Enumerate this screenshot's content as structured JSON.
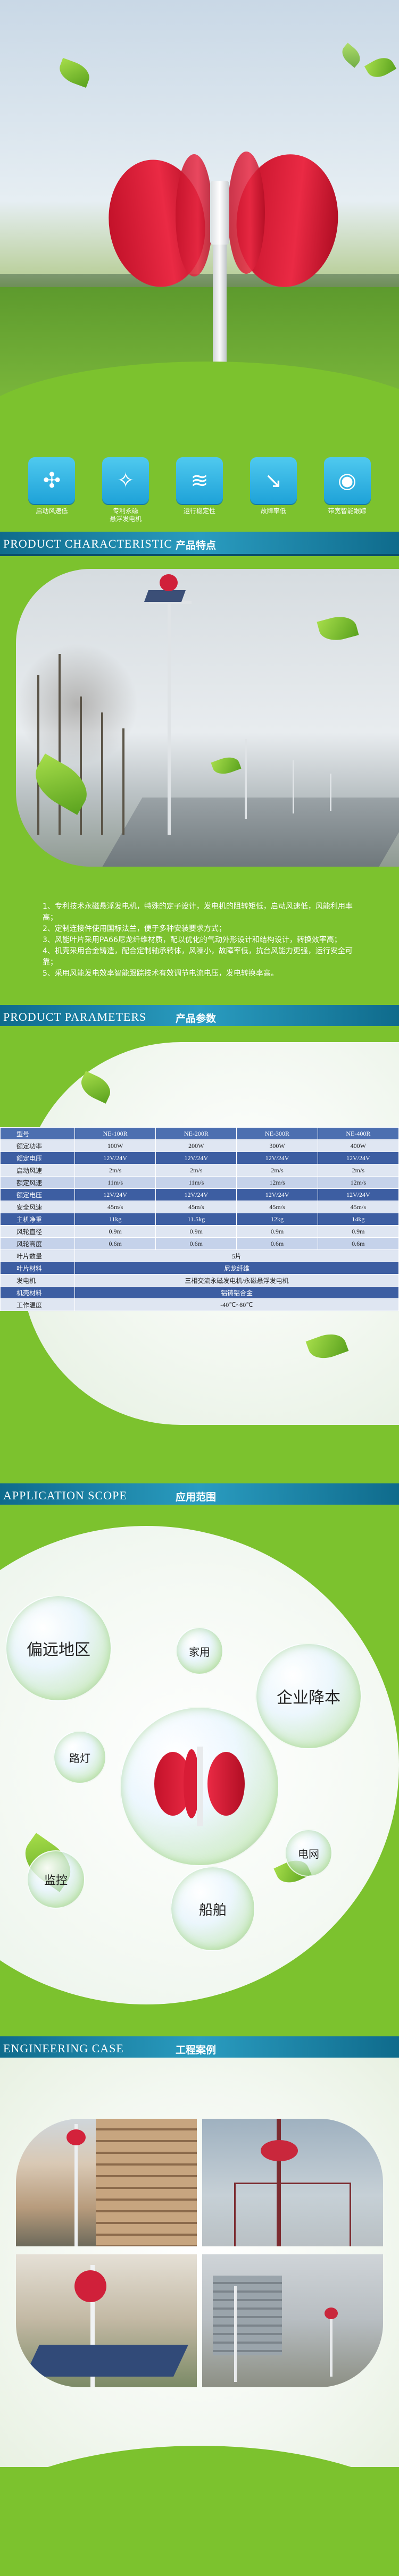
{
  "hero": {
    "features": [
      {
        "icon": "wind-start-icon",
        "glyph": "✣",
        "label": "启动风速低"
      },
      {
        "icon": "magnet-icon",
        "glyph": "✧",
        "label": "专利永磁\n悬浮发电机"
      },
      {
        "icon": "smooth-run-icon",
        "glyph": "≋",
        "label": "运行稳定性"
      },
      {
        "icon": "low-fault-icon",
        "glyph": "↘",
        "label": "故障率低"
      },
      {
        "icon": "smart-control-icon",
        "glyph": "◉",
        "label": "带宽智能跟踪"
      }
    ]
  },
  "sections": {
    "characteristics": {
      "en": "PRODUCT CHARACTERISTIC",
      "cn": "产品特点"
    },
    "parameters": {
      "en": "PRODUCT PARAMETERS",
      "cn": "产品参数"
    },
    "application": {
      "en": "APPLICATION SCOPE",
      "cn": "应用范围"
    },
    "cases": {
      "en": "ENGINEERING CASE",
      "cn": "工程案例"
    }
  },
  "characteristics": {
    "lines": [
      "1、专利技术永磁悬浮发电机，特殊的定子设计，发电机的阻转矩低，启动风速低，风能利用率高；",
      "2、定制连接件使用国标法兰，便于多种安装要求方式；",
      "3、风能叶片采用PA66尼龙纤维材质，配以优化的气动外形设计和结构设计，转换效率高；",
      "4、机壳采用合金铸造，配合定制轴承转体，风噪小，故障率低，抗台风能力更强，运行安全可靠；",
      "5、采用风能发电效率智能跟踪技术有效调节电流电压，发电转换率高。"
    ]
  },
  "parameters": {
    "header": [
      "型号",
      "NE-100R",
      "NE-200R",
      "NE-300R",
      "NE-400R"
    ],
    "rows": [
      {
        "style": "odd",
        "cells": [
          "额定功率",
          "100W",
          "200W",
          "300W",
          "400W"
        ]
      },
      {
        "style": "blue",
        "cells": [
          "额定电压",
          "12V/24V",
          "12V/24V",
          "12V/24V",
          "12V/24V"
        ]
      },
      {
        "style": "odd",
        "cells": [
          "启动风速",
          "2m/s",
          "2m/s",
          "2m/s",
          "2m/s"
        ]
      },
      {
        "style": "even",
        "cells": [
          "额定风速",
          "11m/s",
          "11m/s",
          "12m/s",
          "12m/s"
        ]
      },
      {
        "style": "blue",
        "cells": [
          "额定电压",
          "12V/24V",
          "12V/24V",
          "12V/24V",
          "12V/24V"
        ]
      },
      {
        "style": "odd",
        "cells": [
          "安全风速",
          "45m/s",
          "45m/s",
          "45m/s",
          "45m/s"
        ]
      },
      {
        "style": "blue",
        "cells": [
          "主机净重",
          "11kg",
          "11.5kg",
          "12kg",
          "14kg"
        ]
      },
      {
        "style": "odd",
        "cells": [
          "风轮直径",
          "0.9m",
          "0.9m",
          "0.9m",
          "0.9m"
        ]
      },
      {
        "style": "even",
        "cells": [
          "风轮高度",
          "0.6m",
          "0.6m",
          "0.6m",
          "0.6m"
        ]
      }
    ],
    "merged": [
      {
        "label": "叶片数量",
        "value": "5片"
      },
      {
        "label": "叶片材料",
        "value": "尼龙纤维"
      },
      {
        "label": "发电机",
        "value": "三相交流永磁发电机/永磁悬浮发电机"
      },
      {
        "label": "机壳材料",
        "value": "铝铸铝合金"
      },
      {
        "label": "工作温度",
        "value": "-40℃~80℃"
      }
    ]
  },
  "application": {
    "bubbles": [
      {
        "name": "bubble-remote-area",
        "text": "偏远地区"
      },
      {
        "name": "bubble-household",
        "text": "家用"
      },
      {
        "name": "bubble-enterprise",
        "text": "企业降本"
      },
      {
        "name": "bubble-street-lamp",
        "text": "路灯"
      },
      {
        "name": "bubble-power-grid",
        "text": "电网"
      },
      {
        "name": "bubble-monitoring",
        "text": "监控"
      },
      {
        "name": "bubble-ship",
        "text": "船舶"
      }
    ]
  }
}
